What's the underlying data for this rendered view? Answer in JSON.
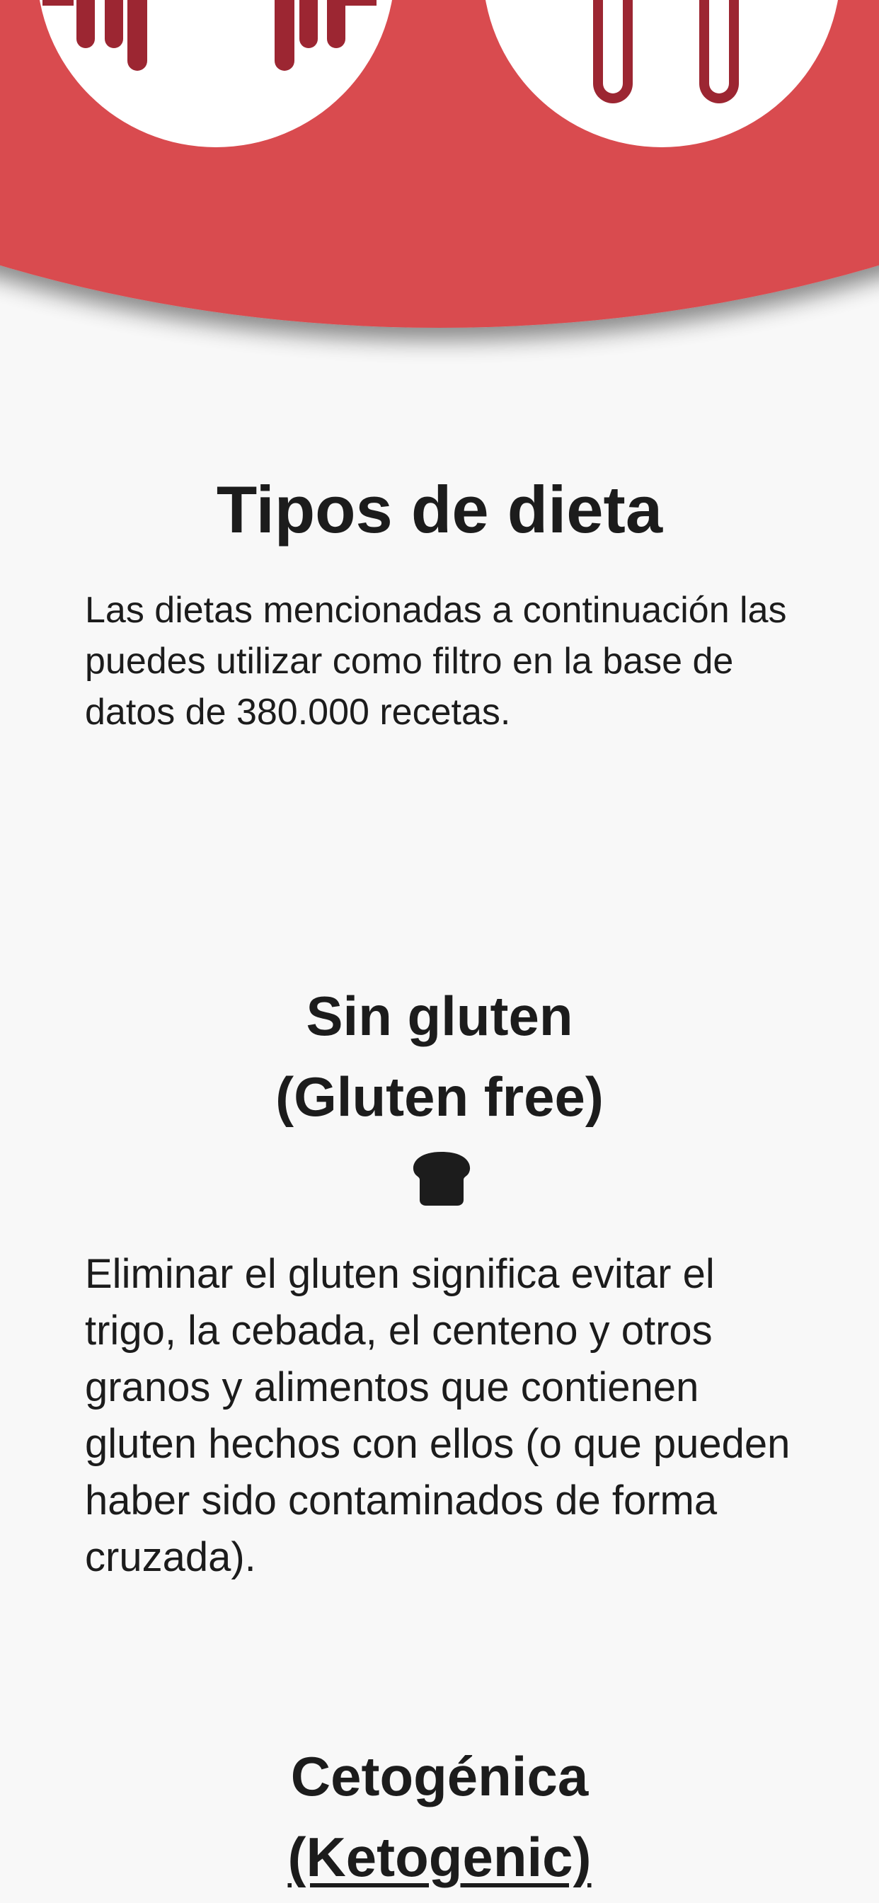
{
  "header": {
    "background_color": "#d94c50",
    "icon_color": "#9c2632"
  },
  "page": {
    "title": "Tipos de dieta",
    "intro": "Las dietas mencionadas a continuación las puedes utilizar como filtro en la base de datos de 380.000 recetas."
  },
  "sections": [
    {
      "title_line1": "Sin gluten",
      "title_line2": "(Gluten free)",
      "icon": "bread-icon",
      "description": "Eliminar el gluten significa evitar el trigo, la cebada, el centeno y otros granos y alimentos que contienen gluten hechos con ellos (o que pueden haber sido contaminados de forma cruzada)."
    },
    {
      "title_line1": "Cetogénica",
      "title_line2": "(Ketogenic)"
    }
  ]
}
